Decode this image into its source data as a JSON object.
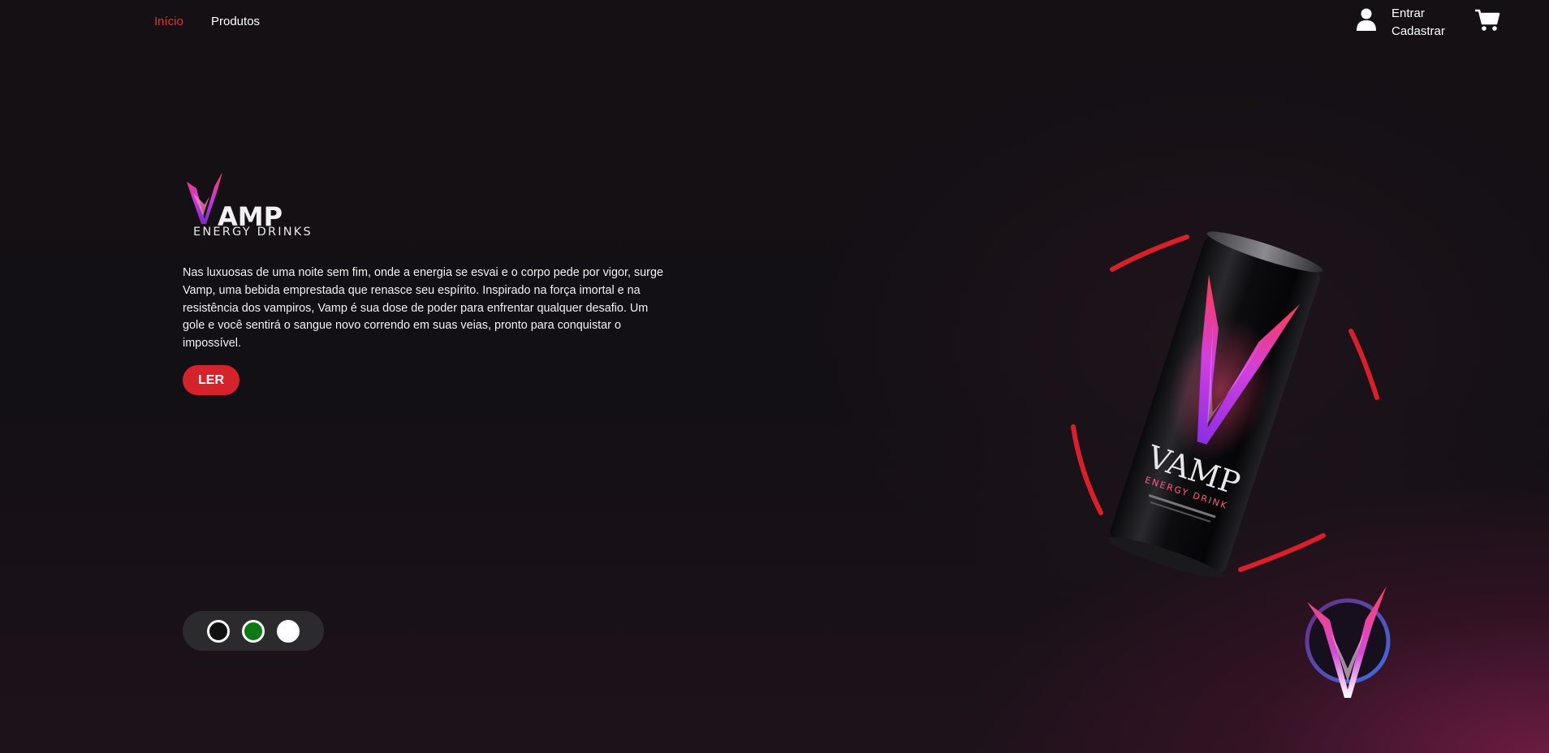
{
  "nav": {
    "home": "Início",
    "products": "Produtos"
  },
  "auth": {
    "login": "Entrar",
    "register": "Cadastrar"
  },
  "icons": {
    "user": "user-icon",
    "cart": "cart-icon"
  },
  "hero": {
    "logo_word": "AMP",
    "logo_subtitle": "ENERGY DRINKS",
    "description": "Nas luxuosas de uma noite sem fim, onde a energia se esvai e o corpo pede por vigor, surge Vamp, uma bebida emprestada que renasce seu espírito. Inspirado na força imortal e na resistência dos vampiros, Vamp é sua dose de poder para enfrentar qualquer desafio. Um gole e você sentirá o sangue novo correndo em suas veias, pronto para conquistar o impossível.",
    "read_button": "LER"
  },
  "product": {
    "can_brand": "VAMP",
    "can_subtitle": "ENERGY DRINK"
  },
  "carousel": {
    "dots": [
      {
        "color": "#111111"
      },
      {
        "color": "#0b7a12"
      },
      {
        "color": "#ffffff"
      }
    ]
  },
  "colors": {
    "accent": "#d5232b",
    "active_nav": "#e0323a",
    "ring": "#d9202a"
  }
}
